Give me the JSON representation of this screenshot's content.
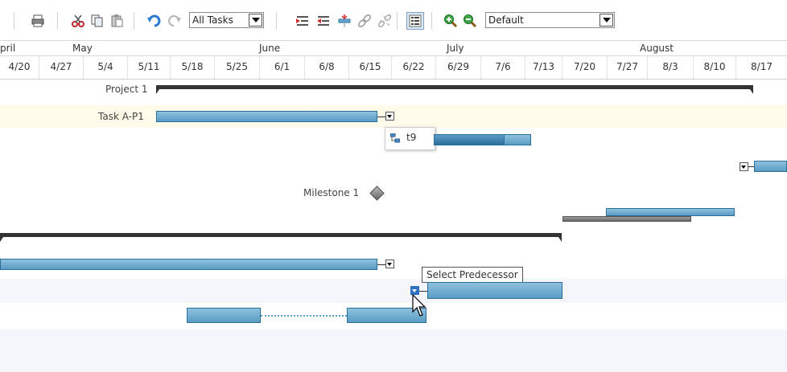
{
  "toolbar": {
    "tasks_filter": "All Tasks",
    "zoom_preset": "Default",
    "icons": [
      "print-icon",
      "cut-icon",
      "copy-icon",
      "paste-icon",
      "undo-icon",
      "redo-icon",
      "indent-icon",
      "outdent-icon",
      "insert-task-icon",
      "link-icon",
      "unlink-icon",
      "list-view-icon",
      "zoom-in-icon",
      "zoom-out-icon"
    ]
  },
  "timeline": {
    "months": [
      "pril",
      "May",
      "June",
      "July",
      "August"
    ],
    "weeks": [
      "4/20",
      "4/27",
      "5/4",
      "5/11",
      "5/18",
      "5/25",
      "6/1",
      "6/8",
      "6/15",
      "6/22",
      "6/29",
      "7/6",
      "7/13",
      "7/20",
      "7/27",
      "8/3",
      "8/10",
      "8/17"
    ]
  },
  "tasks": {
    "project1": "Project 1",
    "taskAP1": "Task A-P1",
    "milestone1": "Milestone 1"
  },
  "popup": {
    "item": "t9"
  },
  "tooltip": {
    "text": "Select Predecessor"
  },
  "colors": {
    "bar": "#5a9cc4",
    "summary": "#333333",
    "selected_row": "#fffbea"
  }
}
